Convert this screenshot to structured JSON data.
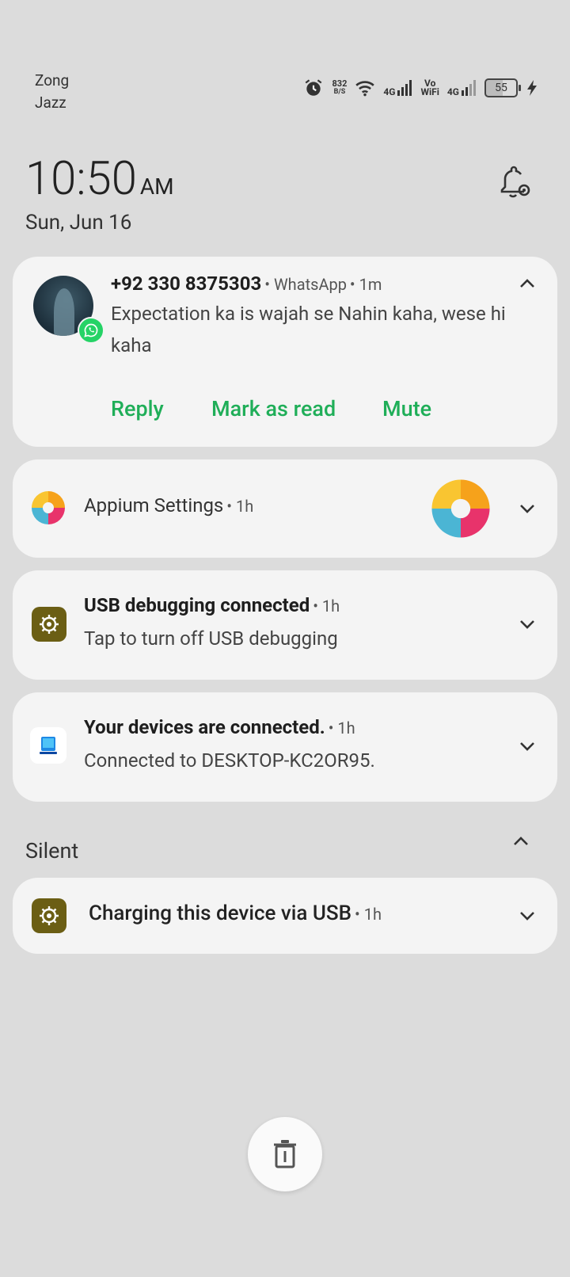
{
  "status_bar": {
    "carrier_1": "Zong",
    "carrier_2": "Jazz",
    "speed_value": "832",
    "speed_unit": "B/S",
    "network_1": "4G",
    "vowifi_top": "Vo",
    "vowifi_bottom": "WiFi",
    "network_2": "4G",
    "battery_level": "55",
    "icons": [
      "alarm-icon",
      "wifi-icon",
      "signal-icon",
      "signal-icon",
      "battery-icon",
      "charging-bolt-icon"
    ]
  },
  "header": {
    "time": "10:50",
    "ampm": "AM",
    "date": "Sun, Jun 16"
  },
  "notifications": [
    {
      "title": "+92 330 8375303",
      "app": "WhatsApp",
      "time": "1m",
      "body": "Expectation ka is wajah se Nahin kaha, wese hi kaha",
      "actions": [
        "Reply",
        "Mark as read",
        "Mute"
      ]
    },
    {
      "app": "Appium Settings",
      "time": "1h"
    },
    {
      "title": "USB debugging connected",
      "time": "1h",
      "body": "Tap to turn off USB debugging"
    },
    {
      "title": "Your devices are connected.",
      "time": "1h",
      "body": "Connected to DESKTOP-KC2OR95."
    }
  ],
  "silent_section": {
    "label": "Silent",
    "items": [
      {
        "title": "Charging this device via USB",
        "time": "1h"
      }
    ]
  },
  "colors": {
    "background": "#dcdcdc",
    "card": "#f4f4f4",
    "action_green": "#1fae58",
    "whatsapp_green": "#25d366",
    "android_system_icon": "#6b5e14"
  }
}
